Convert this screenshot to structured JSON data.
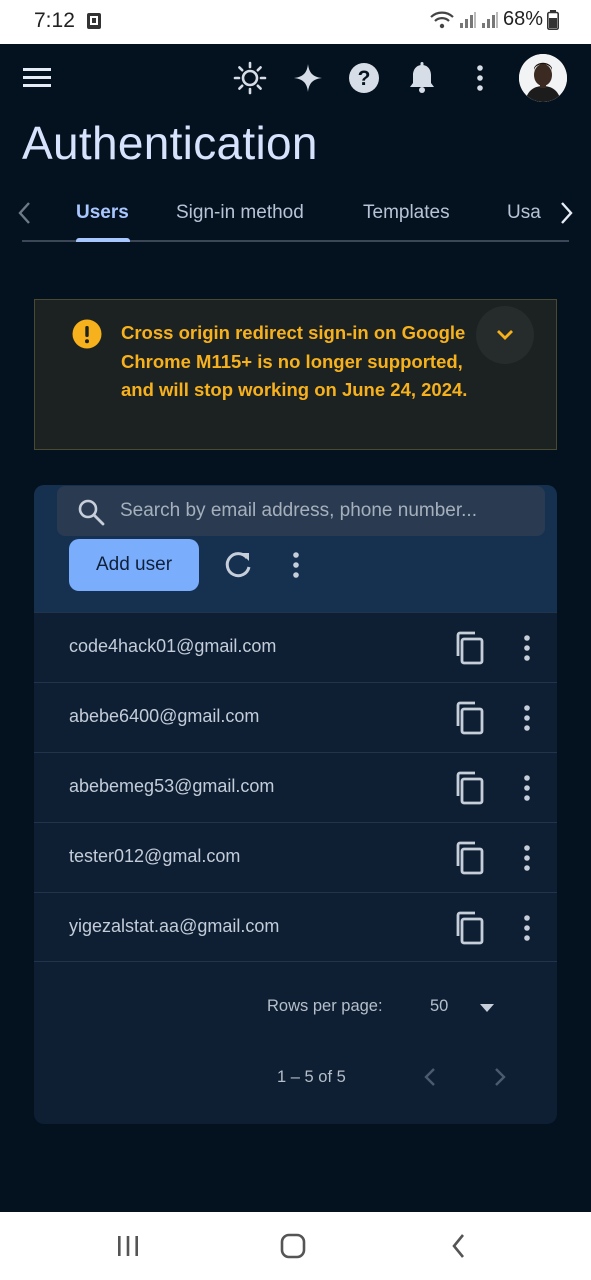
{
  "status_bar": {
    "time": "7:12",
    "battery": "68%"
  },
  "header": {
    "icons": [
      "menu-icon",
      "sun-icon",
      "sparkle-icon",
      "help-icon",
      "bell-icon",
      "more-vert-icon",
      "avatar"
    ]
  },
  "page_title": "Authentication",
  "tabs": [
    {
      "label": "Users",
      "active": true
    },
    {
      "label": "Sign-in method",
      "active": false
    },
    {
      "label": "Templates",
      "active": false
    },
    {
      "label": "Usa",
      "active": false
    }
  ],
  "banner": {
    "message": "Cross origin redirect sign-in on Google Chrome M115+ is no longer supported, and will stop working on June 24, 2024.",
    "color": "#f6b11d"
  },
  "users": {
    "search_placeholder": "Search by email address, phone number...",
    "add_user_label": "Add user",
    "rows": [
      {
        "email": "code4hack01@gmail.com"
      },
      {
        "email": "abebe6400@gmail.com"
      },
      {
        "email": "abebemeg53@gmail.com"
      },
      {
        "email": "tester012@gmal.com"
      },
      {
        "email": "yigezalstat.aa@gmail.com"
      }
    ],
    "rows_per_page_label": "Rows per page:",
    "rows_per_page_value": "50",
    "range_label": "1 – 5 of 5"
  },
  "colors": {
    "background": "#04111f",
    "accent": "#a9c7ff",
    "button": "#7aaefc",
    "warning": "#f6b11d"
  }
}
